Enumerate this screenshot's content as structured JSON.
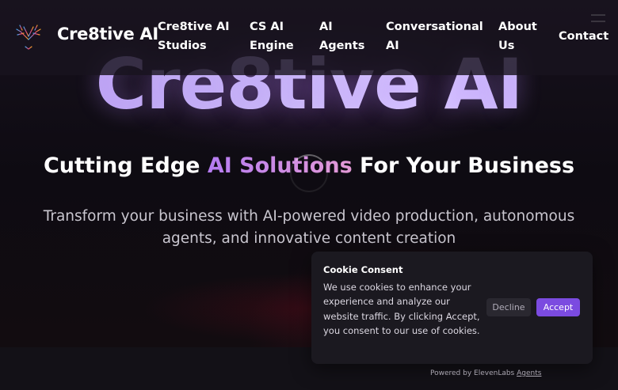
{
  "header": {
    "brand": "Cre8tive AI",
    "logo_icon": "tree-logo-icon",
    "nav": [
      {
        "line1": "Cre8tive AI",
        "line2": "Studios"
      },
      {
        "line1": "CS AI",
        "line2": "Engine"
      },
      {
        "line1": "AI",
        "line2": "Agents"
      },
      {
        "line1": "Conversational",
        "line2": "AI"
      },
      {
        "line1": "About",
        "line2": "Us"
      },
      {
        "line1": "Contact",
        "line2": ""
      }
    ]
  },
  "hero": {
    "big_title": "Cre8tive AI",
    "tagline_start": "Cutting Edge ",
    "tagline_accent": "AI Solutions",
    "tagline_end": " For Your Business",
    "subtitle": "Transform your business with AI-powered video production, autonomous agents, and innovative content creation"
  },
  "cookie": {
    "title": "Cookie Consent",
    "text": "We use cookies to enhance your experience and analyze our website traffic. By clicking Accept, you consent to our use of cookies.",
    "decline_label": "Decline",
    "accept_label": "Accept"
  },
  "footer": {
    "powered_prefix": "Powered by ElevenLabs ",
    "powered_link": "Agents"
  },
  "colors": {
    "accent_purple": "#7b4be0",
    "tagline_gradient_start": "#b57cf2",
    "tagline_gradient_end": "#e49ad6"
  }
}
